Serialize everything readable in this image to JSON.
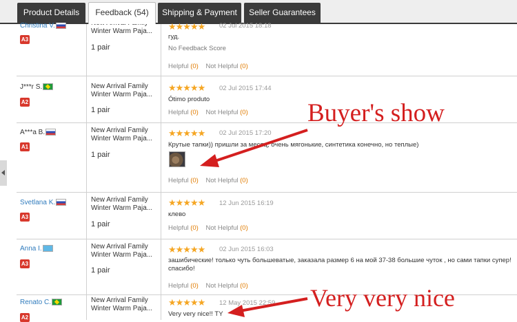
{
  "tabs": [
    {
      "label": "Product Details"
    },
    {
      "label": "Feedback (54)"
    },
    {
      "label": "Shipping & Payment"
    },
    {
      "label": "Seller Guarantees"
    }
  ],
  "active_tab": 1,
  "helpful_label": "Helpful",
  "not_helpful_label": "Not Helpful",
  "reviews": [
    {
      "buyer": "Christina V.",
      "country": "ru",
      "level": "A3",
      "product": "New Arrival Family Winter Warm Paja...",
      "quantity": "1 pair",
      "stars": "★★★★★",
      "date": "02 Jul 2015 18:18",
      "text": "гуд.",
      "note": "No Feedback Score",
      "helpful": "(0)",
      "not_helpful": "(0)"
    },
    {
      "buyer": "J***r S.",
      "country": "br",
      "level": "A2",
      "product": "New Arrival Family Winter Warm Paja...",
      "quantity": "1 pair",
      "stars": "★★★★★",
      "date": "02 Jul 2015 17:44",
      "text": "Ótimo produto",
      "helpful": "(0)",
      "not_helpful": "(0)"
    },
    {
      "buyer": "A***a B.",
      "country": "ru",
      "level": "A1",
      "product": "New Arrival Family Winter Warm Paja...",
      "quantity": "1 pair",
      "stars": "★★★★★",
      "date": "02 Jul 2015 17:20",
      "text": "Крутые тапки)) пришли за месяц, очень мягонькие, синтетика конечно, но теплые)",
      "helpful": "(0)",
      "not_helpful": "(0)"
    },
    {
      "buyer": "Svetlana K.",
      "country": "ru",
      "level": "A3",
      "product": "New Arrival Family Winter Warm Paja...",
      "quantity": "1 pair",
      "stars": "★★★★★",
      "date": "12 Jun 2015 16:19",
      "text": "клево",
      "helpful": "(0)",
      "not_helpful": "(0)"
    },
    {
      "buyer": "Anna I.",
      "country": "kz",
      "level": "A3",
      "product": "New Arrival Family Winter Warm Paja...",
      "quantity": "1 pair",
      "stars": "★★★★★",
      "date": "02 Jun 2015 16:03",
      "text": "зашибические! только чуть большеватые, заказала размер 6 на мой 37-38 большие чуток , но сами тапки супер! спасибо!",
      "helpful": "(0)",
      "not_helpful": "(0)"
    },
    {
      "buyer": "Renato C.",
      "country": "br",
      "level": "A2",
      "product": "New Arrival Family Winter Warm Paja...",
      "quantity": "",
      "stars": "★★★★★",
      "date": "12 May 2015 22:59",
      "text": "Very very nice!! TY"
    }
  ],
  "annotations": {
    "buyers_show": "Buyer's show",
    "very_nice": "Very very nice"
  },
  "colors": {
    "annotation": "#d41f1f",
    "star": "#f5a623",
    "link": "#2f7bbd",
    "level_badge": "#d8382c"
  }
}
